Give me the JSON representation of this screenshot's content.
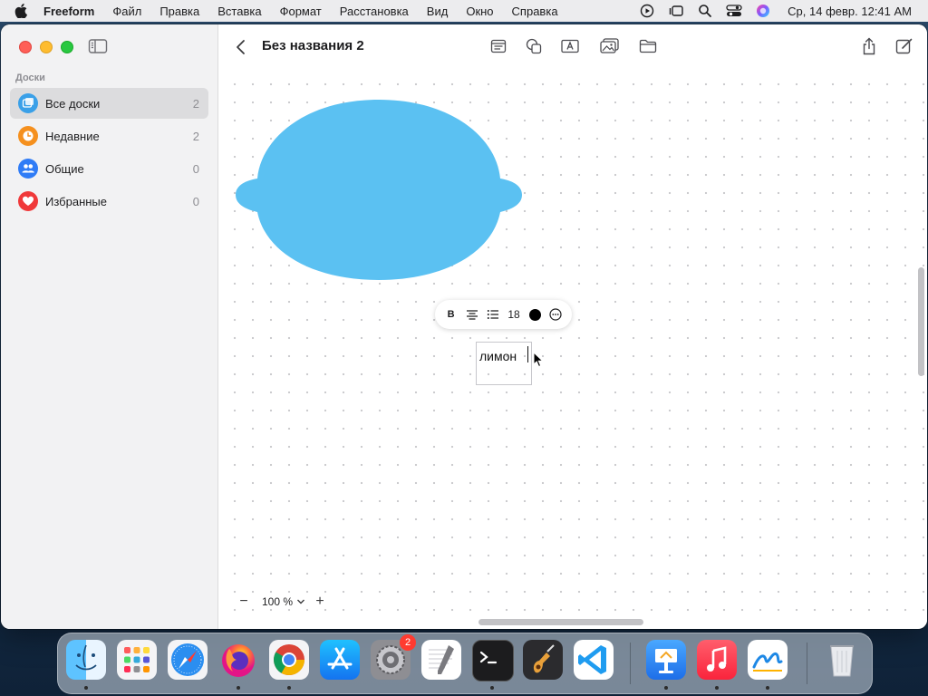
{
  "menubar": {
    "app_name": "Freeform",
    "items": [
      "Файл",
      "Правка",
      "Вставка",
      "Формат",
      "Расстановка",
      "Вид",
      "Окно",
      "Справка"
    ],
    "clock": "Ср, 14 февр.  12:41 AM",
    "status_icons": [
      "play-circle-icon",
      "stage-manager-icon",
      "search-icon",
      "control-center-icon",
      "siri-icon"
    ]
  },
  "sidebar": {
    "heading": "Доски",
    "items": [
      {
        "label": "Все доски",
        "count": "2",
        "icon": "boards-icon",
        "color": "#3aa0e8",
        "selected": true
      },
      {
        "label": "Недавние",
        "count": "2",
        "icon": "clock-icon",
        "color": "#f5901e"
      },
      {
        "label": "Общие",
        "count": "0",
        "icon": "people-icon",
        "color": "#2f7cf6"
      },
      {
        "label": "Избранные",
        "count": "0",
        "icon": "heart-icon",
        "color": "#f0393a"
      }
    ]
  },
  "toolbar": {
    "title": "Без названия 2",
    "tools": [
      "sticky-note-icon",
      "shapes-icon",
      "text-box-icon",
      "media-icon",
      "folder-icon"
    ],
    "right_tools": [
      "share-icon",
      "new-board-icon"
    ]
  },
  "canvas": {
    "shape_color": "#5bc1f2",
    "format_bar": {
      "bold": "B",
      "font_size": "18",
      "text_color": "#000000",
      "tools": [
        "bold-button",
        "align-center-icon",
        "list-icon",
        "font-size",
        "color-well",
        "more-icon"
      ]
    },
    "text_box": {
      "text": "лимон"
    },
    "zoom": {
      "value": "100 %",
      "minus": "−",
      "plus": "+"
    }
  },
  "dock": {
    "apps": [
      "Finder",
      "Launchpad",
      "Safari",
      "Firefox",
      "Chrome",
      "App Store",
      "System Settings",
      "TextEdit",
      "Terminal",
      "GarageBand",
      "Visual Studio Code",
      "Keynote",
      "Music",
      "Freeform",
      "Trash"
    ],
    "settings_badge": "2"
  }
}
